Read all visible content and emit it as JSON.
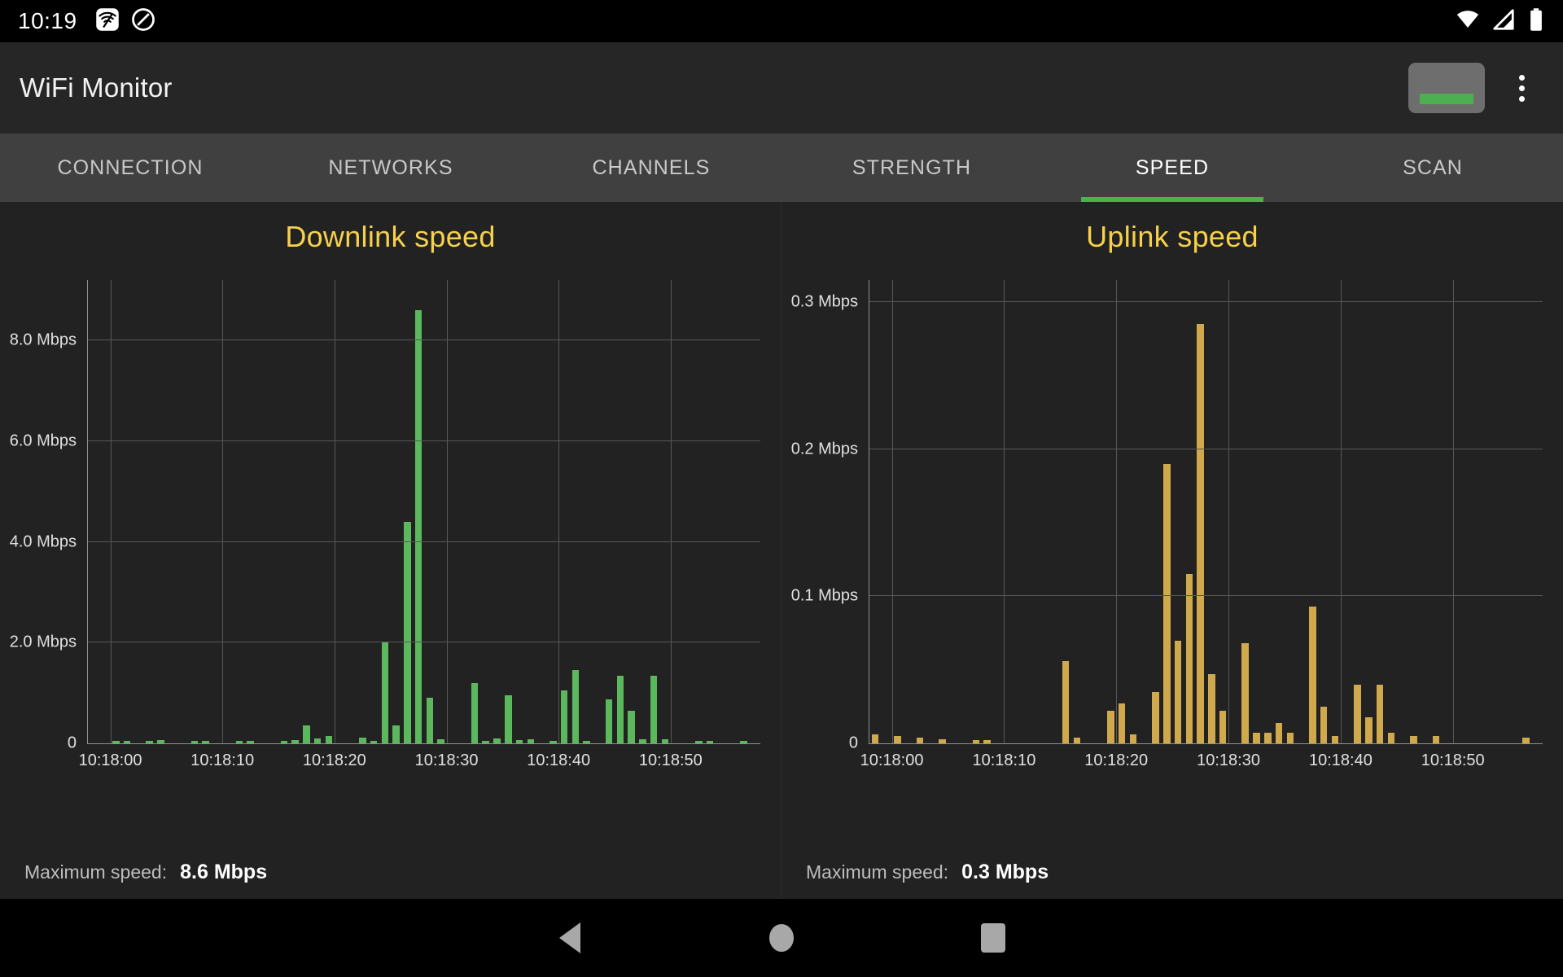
{
  "status_bar": {
    "clock": "10:19",
    "left_icons": [
      "wifi-monitor-app-icon",
      "do-not-disturb-icon"
    ],
    "right_icons": [
      "wifi-icon",
      "cellular-signal-off-icon",
      "battery-full-icon"
    ]
  },
  "app_bar": {
    "title": "WiFi Monitor",
    "signal_level_button": "signal-level-indicator",
    "overflow_menu": "more-options"
  },
  "tabs": [
    {
      "label": "CONNECTION",
      "active": false
    },
    {
      "label": "NETWORKS",
      "active": false
    },
    {
      "label": "CHANNELS",
      "active": false
    },
    {
      "label": "STRENGTH",
      "active": false
    },
    {
      "label": "SPEED",
      "active": true
    },
    {
      "label": "SCAN",
      "active": false
    }
  ],
  "colors": {
    "accent_green": "#4caf50",
    "bar_green": "#5cb85c",
    "bar_amber": "#cfa94b",
    "title_yellow": "#f7d14b",
    "background": "#222222",
    "app_bar": "#262626",
    "tab_bar": "#404040"
  },
  "downlink": {
    "footer_label": "Maximum speed:",
    "footer_value": "8.6 Mbps"
  },
  "uplink": {
    "footer_label": "Maximum speed:",
    "footer_value": "0.3 Mbps"
  },
  "nav_bar": {
    "back": "back-icon",
    "home": "home-icon",
    "recents": "recents-icon"
  },
  "chart_data": [
    {
      "type": "bar",
      "id": "downlink-speed-chart",
      "title": "Downlink speed",
      "xlabel": "",
      "ylabel": "",
      "ylim": [
        0,
        9.2
      ],
      "grid": true,
      "legend": "none",
      "color": "#5cb85c",
      "ytick_values": [
        0,
        2,
        4,
        6,
        8
      ],
      "ytick_labels": [
        "0",
        "2.0 Mbps",
        "4.0 Mbps",
        "6.0 Mbps",
        "8.0 Mbps"
      ],
      "xtick_positions": [
        0,
        10,
        20,
        30,
        40,
        50
      ],
      "xtick_labels": [
        "10:18:00",
        "10:18:10",
        "10:18:20",
        "10:18:30",
        "10:18:40",
        "10:18:50"
      ],
      "x_range": [
        -2,
        58
      ],
      "x": [
        -1.5,
        -0.5,
        0.5,
        1.5,
        2.5,
        3.5,
        4.5,
        5.5,
        6.5,
        7.5,
        8.5,
        9.5,
        10.5,
        11.5,
        12.5,
        13.5,
        14.5,
        15.5,
        16.5,
        17.5,
        18.5,
        19.5,
        20.5,
        21.5,
        22.5,
        23.5,
        24.5,
        25.5,
        26.5,
        27.5,
        28.5,
        29.5,
        30.5,
        31.5,
        32.5,
        33.5,
        34.5,
        35.5,
        36.5,
        37.5,
        38.5,
        39.5,
        40.5,
        41.5,
        42.5,
        43.5,
        44.5,
        45.5,
        46.5,
        47.5,
        48.5,
        49.5,
        50.5,
        51.5,
        52.5,
        53.5,
        54.5,
        55.5,
        56.5
      ],
      "values": [
        0,
        0,
        0.04,
        0.03,
        0,
        0.05,
        0.06,
        0,
        0,
        0.05,
        0.05,
        0,
        0,
        0.04,
        0.04,
        0,
        0,
        0.05,
        0.06,
        0.35,
        0.1,
        0.14,
        0,
        0,
        0.12,
        0.05,
        2.0,
        0.35,
        4.4,
        8.6,
        0.9,
        0.08,
        0,
        0,
        1.2,
        0.04,
        0.1,
        0.95,
        0.06,
        0.08,
        0,
        0.05,
        1.05,
        1.45,
        0.03,
        0,
        0.88,
        1.35,
        0.65,
        0.08,
        1.35,
        0.08,
        0,
        0,
        0.04,
        0.03,
        0,
        0,
        0.02
      ],
      "max_value": 8.6,
      "footer": "Maximum speed:   8.6 Mbps"
    },
    {
      "type": "bar",
      "id": "uplink-speed-chart",
      "title": "Uplink speed",
      "xlabel": "",
      "ylabel": "",
      "ylim": [
        0,
        0.315
      ],
      "grid": true,
      "legend": "none",
      "color": "#cfa94b",
      "ytick_values": [
        0,
        0.1,
        0.2,
        0.3
      ],
      "ytick_labels": [
        "0",
        "0.1 Mbps",
        "0.2 Mbps",
        "0.3 Mbps"
      ],
      "xtick_positions": [
        0,
        10,
        20,
        30,
        40,
        50
      ],
      "xtick_labels": [
        "10:18:00",
        "10:18:10",
        "10:18:20",
        "10:18:30",
        "10:18:40",
        "10:18:50"
      ],
      "x_range": [
        -2,
        58
      ],
      "x": [
        -1.5,
        -0.5,
        0.5,
        1.5,
        2.5,
        3.5,
        4.5,
        5.5,
        6.5,
        7.5,
        8.5,
        9.5,
        10.5,
        11.5,
        12.5,
        13.5,
        14.5,
        15.5,
        16.5,
        17.5,
        18.5,
        19.5,
        20.5,
        21.5,
        22.5,
        23.5,
        24.5,
        25.5,
        26.5,
        27.5,
        28.5,
        29.5,
        30.5,
        31.5,
        32.5,
        33.5,
        34.5,
        35.5,
        36.5,
        37.5,
        38.5,
        39.5,
        40.5,
        41.5,
        42.5,
        43.5,
        44.5,
        45.5,
        46.5,
        47.5,
        48.5,
        49.5,
        50.5,
        51.5,
        52.5,
        53.5,
        54.5,
        55.5,
        56.5
      ],
      "values": [
        0.006,
        0,
        0.005,
        0,
        0.004,
        0,
        0.003,
        0,
        0,
        0.002,
        0.002,
        0,
        0,
        0,
        0,
        0,
        0,
        0.056,
        0.004,
        0,
        0,
        0.022,
        0.027,
        0.006,
        0,
        0.035,
        0.19,
        0.07,
        0.115,
        0.285,
        0.047,
        0.022,
        0,
        0.068,
        0.007,
        0.007,
        0.014,
        0.007,
        0,
        0.093,
        0.025,
        0.005,
        0,
        0.04,
        0.018,
        0.04,
        0.007,
        0,
        0.005,
        0,
        0.005,
        0,
        0,
        0,
        0,
        0,
        0,
        0,
        0.004
      ],
      "max_value": 0.3,
      "footer": "Maximum speed:   0.3 Mbps"
    }
  ]
}
